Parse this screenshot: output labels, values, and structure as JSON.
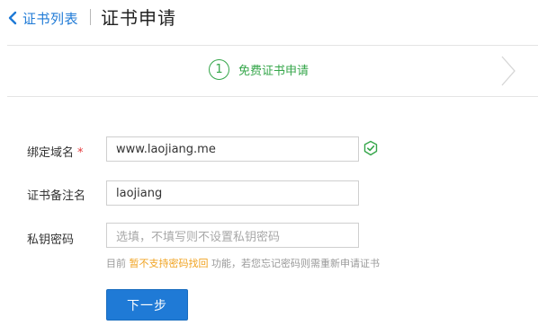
{
  "header": {
    "back_label": "证书列表",
    "title": "证书申请"
  },
  "steps": [
    {
      "number": "1",
      "label": "免费证书申请",
      "state": "active"
    }
  ],
  "form": {
    "domain": {
      "label": "绑定域名",
      "required_mark": "*",
      "value": "www.laojiang.me",
      "valid": true
    },
    "note": {
      "label": "证书备注名",
      "value": "laojiang"
    },
    "key_password": {
      "label": "私钥密码",
      "placeholder": "选填，不填写则不设置私钥密码"
    },
    "hint": {
      "prefix": "目前 ",
      "emphasis": "暂不支持密码找回",
      "suffix": " 功能，若您忘记密码则需重新申请证书"
    }
  },
  "actions": {
    "next_label": "下一步"
  },
  "colors": {
    "primary": "#1f7ad6",
    "success": "#35a64a",
    "required": "#e4393c",
    "warning": "#f0a21f"
  }
}
